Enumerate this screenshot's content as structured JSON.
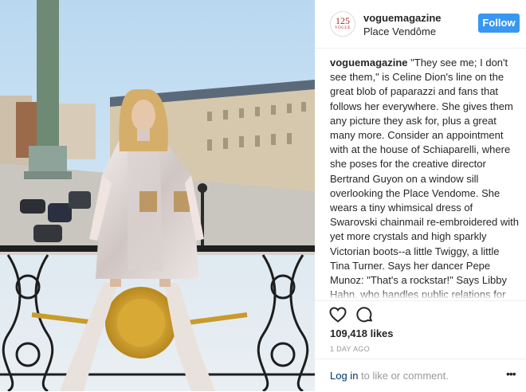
{
  "header": {
    "avatar_mark": "125",
    "avatar_sub": "VOGUE",
    "username": "voguemagazine",
    "location": "Place Vendôme",
    "follow_label": "Follow"
  },
  "caption": {
    "username": "voguemagazine",
    "text": " \"They see me; I don't see them,\" is Celine Dion's line on the great blob of paparazzi and fans that follows her everywhere. She gives them any picture they ask for, plus a great many more. Consider an appointment with at the house of Schiaparelli, where she poses for the creative director Bertrand Guyon on a window sill overlooking the Place Vendome. She wears a tiny whimsical dress of Swarovski chainmail re-embroidered with yet more crystals and high sparkly Victorian boots--a little Twiggy, a little Tina Turner. Says her dancer Pepe Munoz: \"That's a rockstar!\" Says Libby Hahn, who handles public relations for the house: \"I am fairly certain she was a rockstar before she put on the dress.\" Says Celine's own longtime"
  },
  "actions": {
    "like_icon": "heart-icon",
    "comment_icon": "comment-icon",
    "likes": "109,418 likes",
    "time_ago": "1 DAY AGO"
  },
  "footer": {
    "login_link": "Log in",
    "login_rest": " to like or comment.",
    "more_icon": "ellipsis-icon",
    "more_glyph": "•••"
  },
  "colors": {
    "follow_button": "#3897f0",
    "link": "#003569",
    "muted": "#999999",
    "brand_red": "#b3261e"
  }
}
